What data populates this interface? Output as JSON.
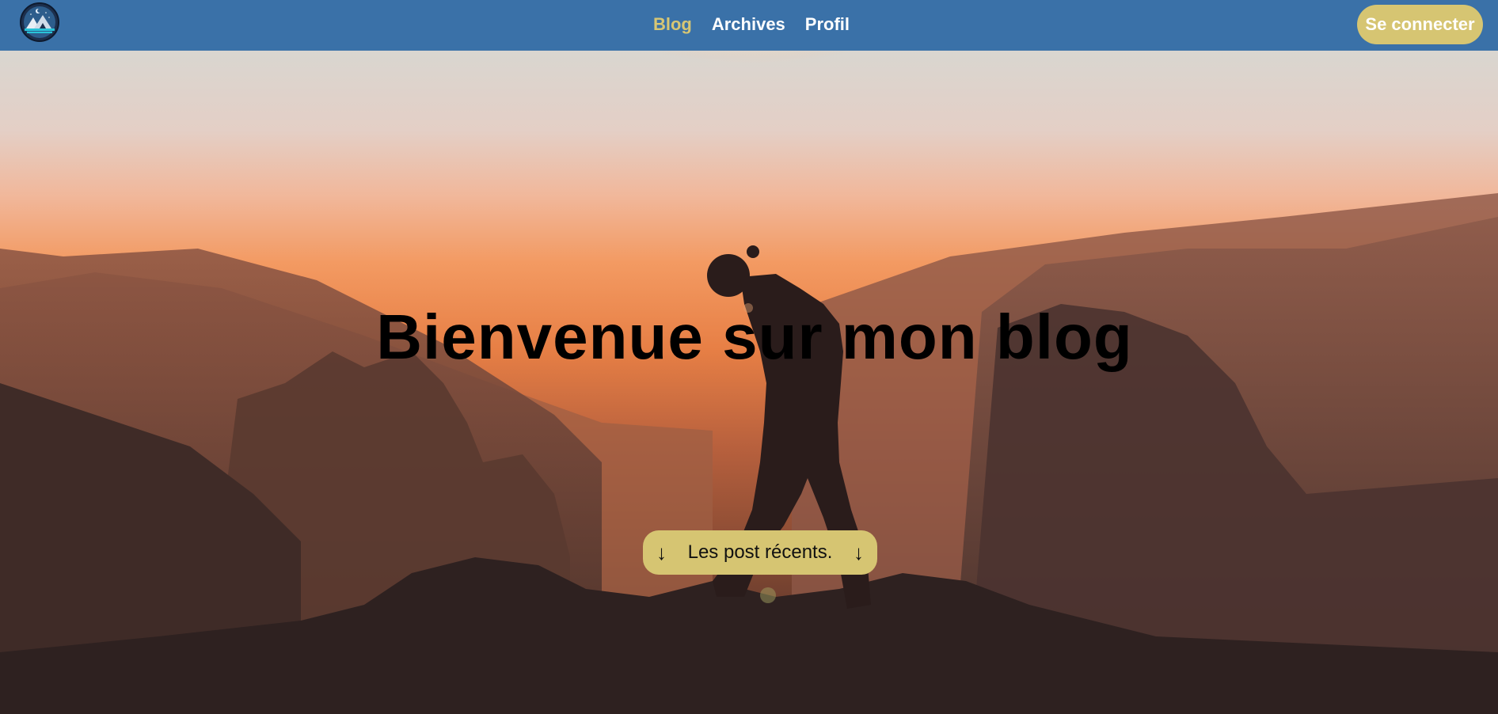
{
  "header": {
    "logo_icon": "mountain-night-logo-icon",
    "nav": [
      {
        "label": "Blog",
        "active": true
      },
      {
        "label": "Archives",
        "active": false
      },
      {
        "label": "Profil",
        "active": false
      }
    ],
    "login_label": "Se connecter"
  },
  "hero": {
    "title": "Bienvenue sur mon blog",
    "cta": {
      "label": "Les post récents.",
      "left_icon": "arrow-down-icon",
      "right_icon": "arrow-down-icon",
      "arrow_glyph": "↓"
    }
  },
  "colors": {
    "navbar": "#3a71a8",
    "accent": "#d6c572",
    "active_link": "#d7c674"
  }
}
